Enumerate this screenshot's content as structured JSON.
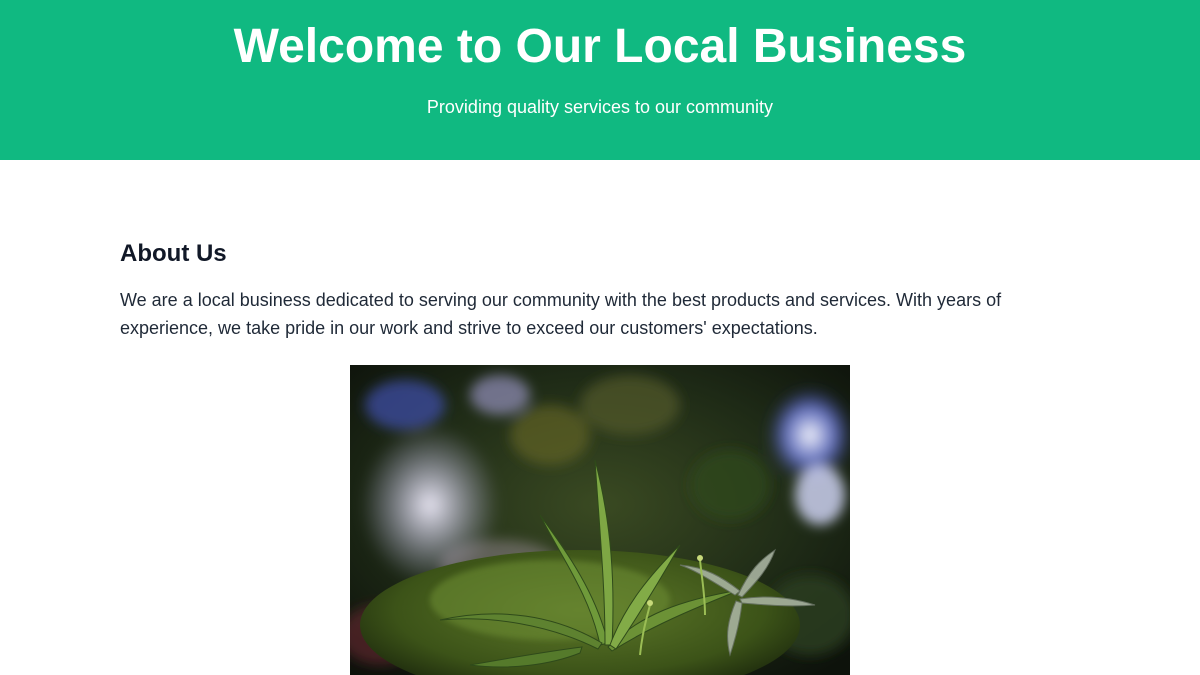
{
  "hero": {
    "title": "Welcome to Our Local Business",
    "subtitle": "Providing quality services to our community",
    "background_color": "#10b981"
  },
  "about": {
    "heading": "About Us",
    "text": "We are a local business dedicated to serving our community with the best products and services. With years of experience, we take pride in our work and strive to exceed our customers' expectations."
  },
  "image": {
    "subject": "plant-on-moss-photo"
  }
}
